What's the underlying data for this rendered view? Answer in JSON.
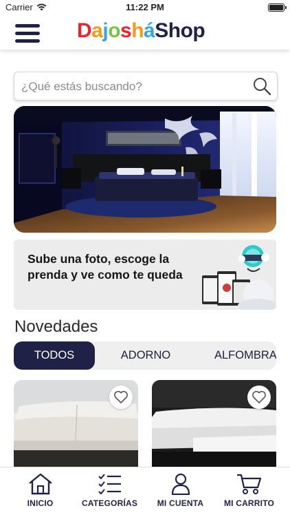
{
  "status_bar": {
    "carrier": "Carrier",
    "time": "11:22 PM"
  },
  "header": {
    "logo_part1": "Dajoshá",
    "logo_part2": "Shop",
    "logo_colors": [
      "#e8262e",
      "#f39a1e",
      "#38a6dd",
      "#7cc242",
      "#e8262e",
      "#f39a1e",
      "#38a6dd"
    ]
  },
  "search": {
    "placeholder": "¿Qué estás buscando?",
    "value": ""
  },
  "promo": {
    "text": "Sube una foto, escoge la prenda y ve como te queda"
  },
  "section": {
    "title": "Novedades"
  },
  "tabs": [
    {
      "label": "TODOS",
      "selected": true
    },
    {
      "label": "ADORNO",
      "selected": false
    },
    {
      "label": "ALFOMBRA",
      "selected": false
    }
  ],
  "bottom_nav": {
    "inicio": "INICIO",
    "categorias": "CATEGORÍAS",
    "cuenta": "MI CUENTA",
    "carrito": "MI CARRITO"
  },
  "colors": {
    "primary": "#1f2147",
    "background": "#ffffff",
    "card": "#ececec"
  }
}
